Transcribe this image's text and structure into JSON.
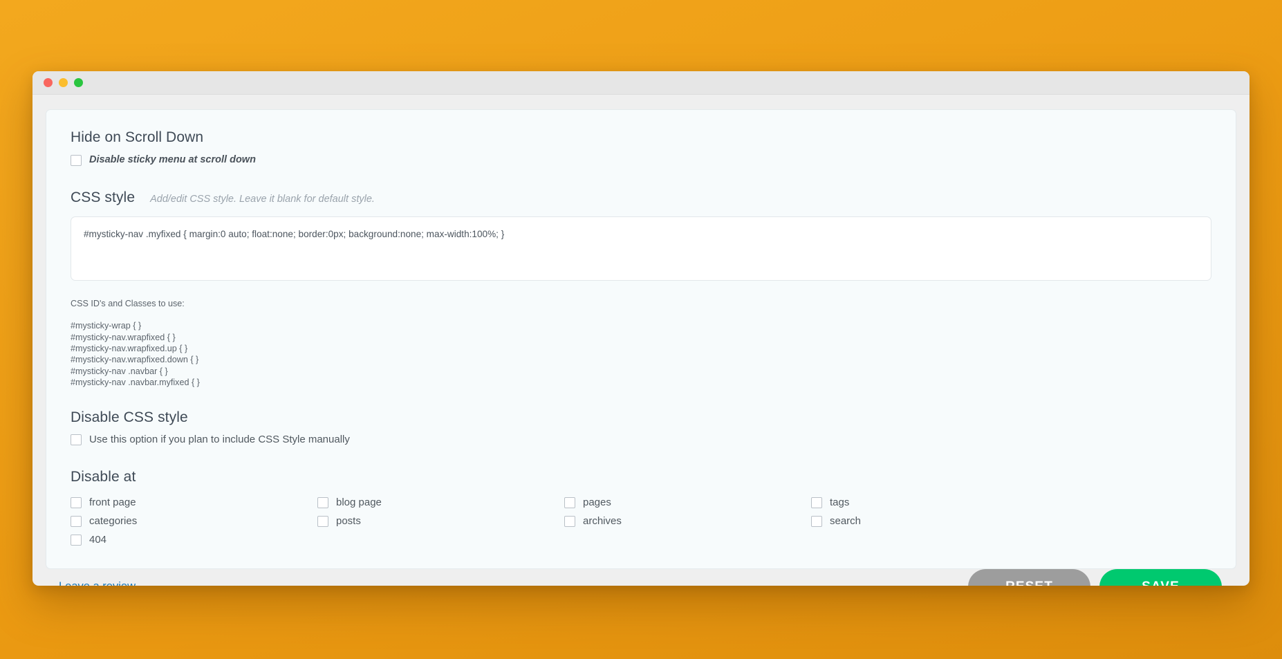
{
  "window": {
    "traffic_lights": [
      {
        "name": "close",
        "color": "#f9665e"
      },
      {
        "name": "minimize",
        "color": "#fbbd2e"
      },
      {
        "name": "maximize",
        "color": "#2ac53f"
      }
    ]
  },
  "hide_on_scroll": {
    "title": "Hide on Scroll Down",
    "checkbox_label": "Disable sticky menu at scroll down",
    "checked": false
  },
  "css_style": {
    "title": "CSS style",
    "hint": "Add/edit CSS style. Leave it blank for default style.",
    "value": "#mysticky-nav .myfixed { margin:0 auto; float:none; border:0px; background:none; max-width:100%; }",
    "placeholder": ""
  },
  "css_ids": {
    "caption": "CSS ID's and Classes to use:",
    "lines": [
      "#mysticky-wrap { }",
      "#mysticky-nav.wrapfixed { }",
      "#mysticky-nav.wrapfixed.up { }",
      "#mysticky-nav.wrapfixed.down { }",
      "#mysticky-nav .navbar { }",
      "#mysticky-nav .navbar.myfixed { }"
    ]
  },
  "disable_css_style": {
    "title": "Disable CSS style",
    "checkbox_label": "Use this option if you plan to include CSS Style manually",
    "checked": false
  },
  "disable_at": {
    "title": "Disable at",
    "options": [
      {
        "name": "front-page",
        "label": "front page",
        "checked": false
      },
      {
        "name": "blog-page",
        "label": "blog page",
        "checked": false
      },
      {
        "name": "pages",
        "label": "pages",
        "checked": false
      },
      {
        "name": "tags",
        "label": "tags",
        "checked": false
      },
      {
        "name": "categories",
        "label": "categories",
        "checked": false
      },
      {
        "name": "posts",
        "label": "posts",
        "checked": false
      },
      {
        "name": "archives",
        "label": "archives",
        "checked": false
      },
      {
        "name": "search",
        "label": "search",
        "checked": false
      },
      {
        "name": "404",
        "label": "404",
        "checked": false
      }
    ]
  },
  "footer": {
    "review_link": "Leave a review",
    "reset_label": "RESET",
    "save_label": "SAVE",
    "reset_color": "#9d9d9d",
    "save_color": "#00c96f",
    "link_color": "#1878b9"
  }
}
